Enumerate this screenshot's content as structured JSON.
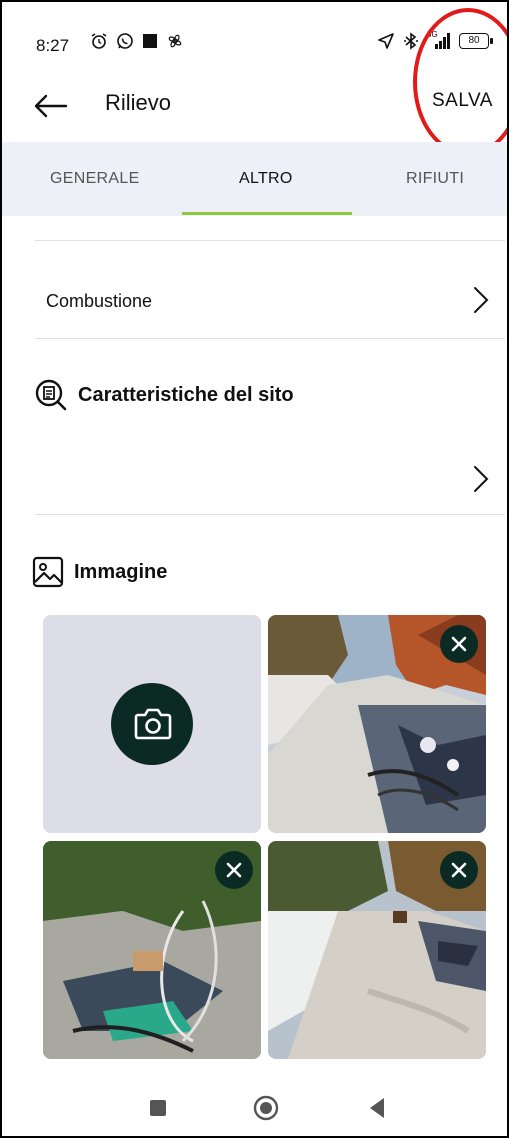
{
  "status_bar": {
    "time": "8:27",
    "left_icons": [
      "alarm-icon",
      "whatsapp-icon",
      "square-icon",
      "fan-icon"
    ],
    "right_icons": [
      "location-arrow-icon",
      "bluetooth-icon",
      "signal-5g-icon",
      "battery-icon"
    ],
    "network": "5G",
    "battery": "80"
  },
  "app_bar": {
    "title": "Rilievo",
    "save_label": "SALVA"
  },
  "tabs": [
    {
      "label": "GENERALE",
      "active": false
    },
    {
      "label": "ALTRO",
      "active": true
    },
    {
      "label": "RIFIUTI",
      "active": false
    }
  ],
  "rows": {
    "combustione": "Combustione"
  },
  "sections": {
    "site_title": "Caratteristiche del sito",
    "image_title": "Immagine"
  },
  "photos": [
    {
      "name": "photo-1",
      "description": "dirt road with dumped waste and dry trees"
    },
    {
      "name": "photo-2",
      "description": "pile of waste with cables and plastic"
    },
    {
      "name": "photo-3",
      "description": "road with white wall and dumped waste"
    }
  ],
  "colors": {
    "accent": "#8dc63f",
    "dark_button": "#0c2a24",
    "tab_background": "#eef0f8",
    "add_tile": "#dcdde6",
    "highlight_circle": "#e21a1a"
  }
}
